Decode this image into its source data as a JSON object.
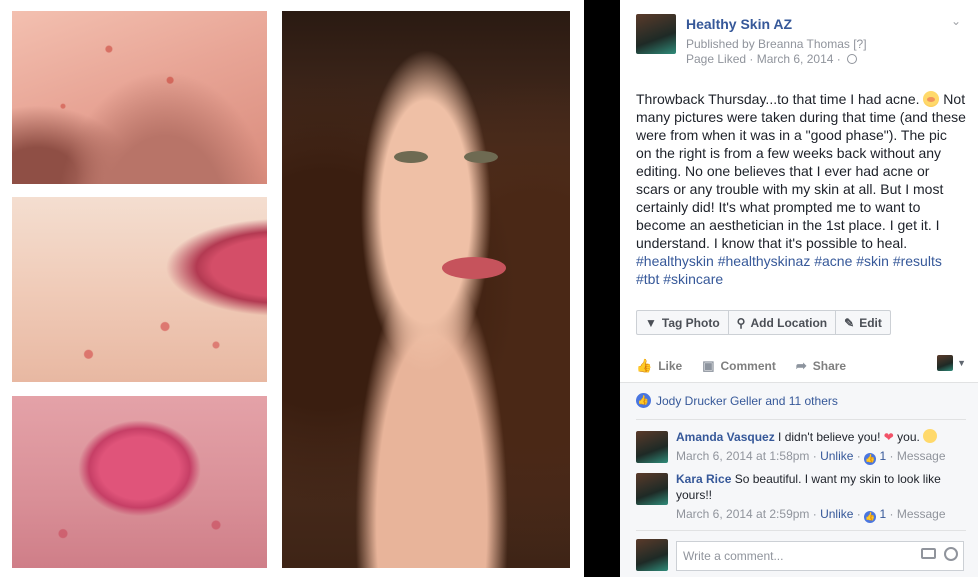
{
  "post": {
    "page_name": "Healthy Skin AZ",
    "published_by": "Published by Breanna Thomas [?]",
    "page_liked": "Page Liked · March 6, 2014 ·",
    "text": "Throwback Thursday...to that time I had acne.",
    "text_rest": " Not many pictures were taken during that time (and these were from when it was in a \"good phase\"). The pic on the right is from a few weeks back without any editing. No one believes that I ever had acne or scars or any trouble with my skin at all. But I most certainly did! It's what prompted me to want to become an aesthetician in the 1st place. I get it. I understand. I know that it's possible to heal.",
    "hashtags": "#healthyskin #healthyskinaz #acne #skin #results #tbt #skincare",
    "emoji_icon": "flushed-face-emoji"
  },
  "photo_actions": [
    {
      "label": "Tag Photo",
      "icon": "tag-icon"
    },
    {
      "label": "Add Location",
      "icon": "location-pin-icon"
    },
    {
      "label": "Edit",
      "icon": "pencil-icon"
    }
  ],
  "actions": {
    "like": "Like",
    "comment": "Comment",
    "share": "Share"
  },
  "likes": {
    "summary": "Jody Drucker Geller and 11 others"
  },
  "comments": [
    {
      "author": "Amanda Vasquez",
      "text_before": "I didn't believe you!",
      "text_after": "you.",
      "time": "March 6, 2014 at 1:58pm",
      "unlike": "Unlike",
      "likes": "1",
      "reply": "Message"
    },
    {
      "author": "Kara Rice",
      "text": "So beautiful. I want my skin to look like yours!!",
      "time": "March 6, 2014 at 2:59pm",
      "unlike": "Unlike",
      "likes": "1",
      "reply": "Message"
    }
  ],
  "composer": {
    "placeholder": "Write a comment..."
  },
  "colors": {
    "link_blue": "#365899",
    "like_blue": "#4a76e0",
    "meta_gray": "#90949c"
  }
}
